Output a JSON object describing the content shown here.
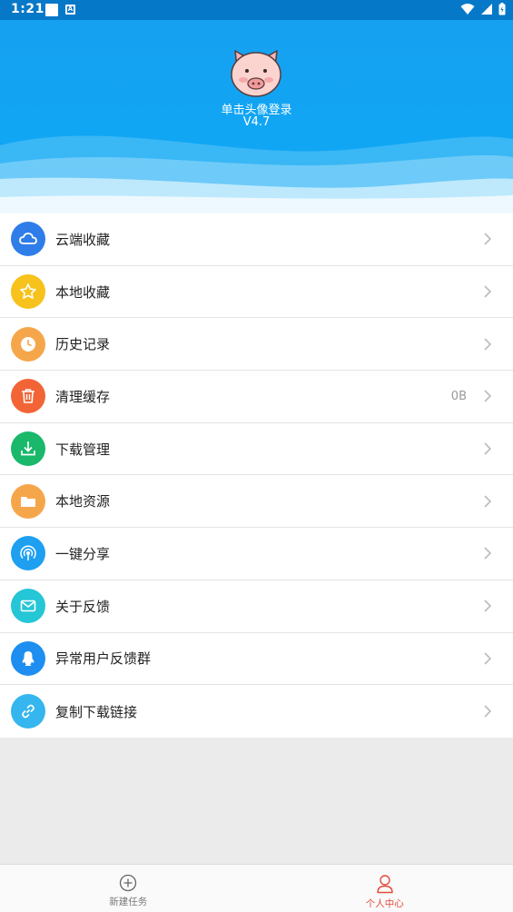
{
  "status_bar": {
    "time": "1:21",
    "mini_icon": "A"
  },
  "header": {
    "login_text": "单击头像登录",
    "version": "V4.7"
  },
  "menu": [
    {
      "label": "云端收藏",
      "icon": "cloud-icon",
      "color": "#2f7de8",
      "value": ""
    },
    {
      "label": "本地收藏",
      "icon": "star-icon",
      "color": "#f6c21b",
      "value": ""
    },
    {
      "label": "历史记录",
      "icon": "clock-icon",
      "color": "#f6a64a",
      "value": ""
    },
    {
      "label": "清理缓存",
      "icon": "trash-icon",
      "color": "#f26436",
      "value": "0B"
    },
    {
      "label": "下载管理",
      "icon": "download-icon",
      "color": "#19b86b",
      "value": ""
    },
    {
      "label": "本地资源",
      "icon": "folder-icon",
      "color": "#f6a64a",
      "value": ""
    },
    {
      "label": "一键分享",
      "icon": "share-signal-icon",
      "color": "#1e9ff0",
      "value": ""
    },
    {
      "label": "关于反馈",
      "icon": "mail-icon",
      "color": "#25c6d6",
      "value": ""
    },
    {
      "label": "异常用户反馈群",
      "icon": "qq-icon",
      "color": "#1e8ff0",
      "value": ""
    },
    {
      "label": "复制下载链接",
      "icon": "link-icon",
      "color": "#35b6ee",
      "value": ""
    }
  ],
  "bottom_nav": {
    "items": [
      {
        "label": "新建任务",
        "icon": "plus-circle-icon",
        "active": false
      },
      {
        "label": "个人中心",
        "icon": "person-icon",
        "active": true
      }
    ],
    "active_color": "#e24a3b"
  }
}
